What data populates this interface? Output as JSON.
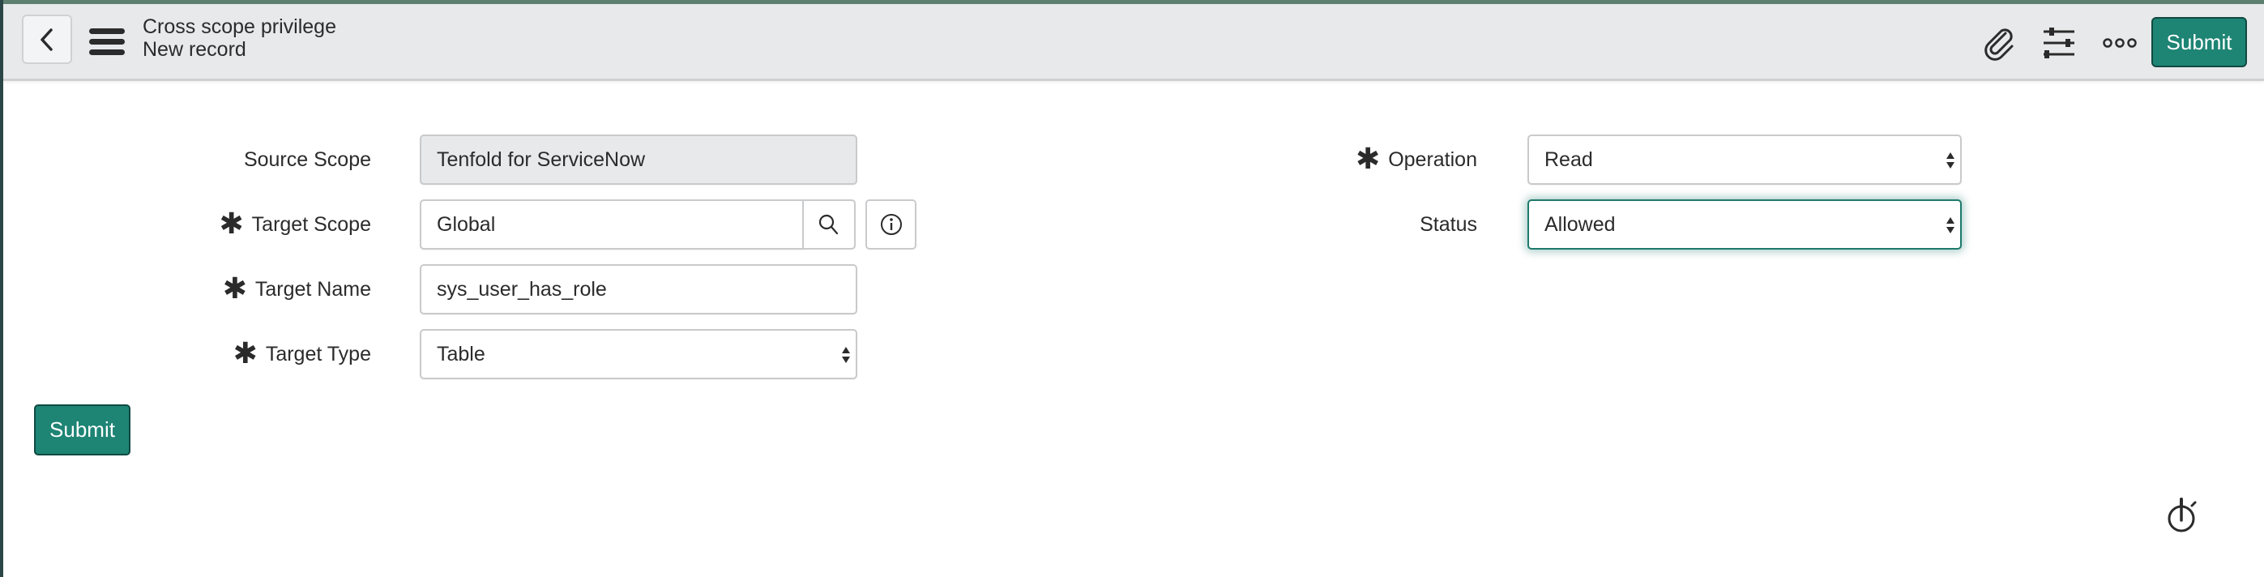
{
  "header": {
    "title": "Cross scope privilege",
    "subtitle": "New record",
    "back_icon": "chevron-left-icon",
    "menu_icon": "hamburger-menu-icon",
    "attachment_icon": "paperclip-icon",
    "personalize_icon": "sliders-icon",
    "more_icon": "more-options-icon",
    "submit_label": "Submit"
  },
  "form": {
    "left_fields": [
      {
        "label": "Source Scope",
        "required": false,
        "value": "Tenfold for ServiceNow",
        "type": "readonly"
      },
      {
        "label": "Target Scope",
        "required": true,
        "value": "Global",
        "type": "reference"
      },
      {
        "label": "Target Name",
        "required": true,
        "value": "sys_user_has_role",
        "type": "text"
      },
      {
        "label": "Target Type",
        "required": true,
        "value": "Table",
        "type": "select"
      }
    ],
    "right_fields": [
      {
        "label": "Operation",
        "required": true,
        "value": "Read",
        "type": "select"
      },
      {
        "label": "Status",
        "required": false,
        "value": "Allowed",
        "type": "select"
      }
    ],
    "required_marker": "✱",
    "submit_label": "Submit"
  },
  "footer": {
    "timer_icon": "stopwatch-icon"
  },
  "colors": {
    "primary": "#1e8474",
    "header_bg": "#e8e9eb",
    "focus": "#1e7a6c"
  }
}
